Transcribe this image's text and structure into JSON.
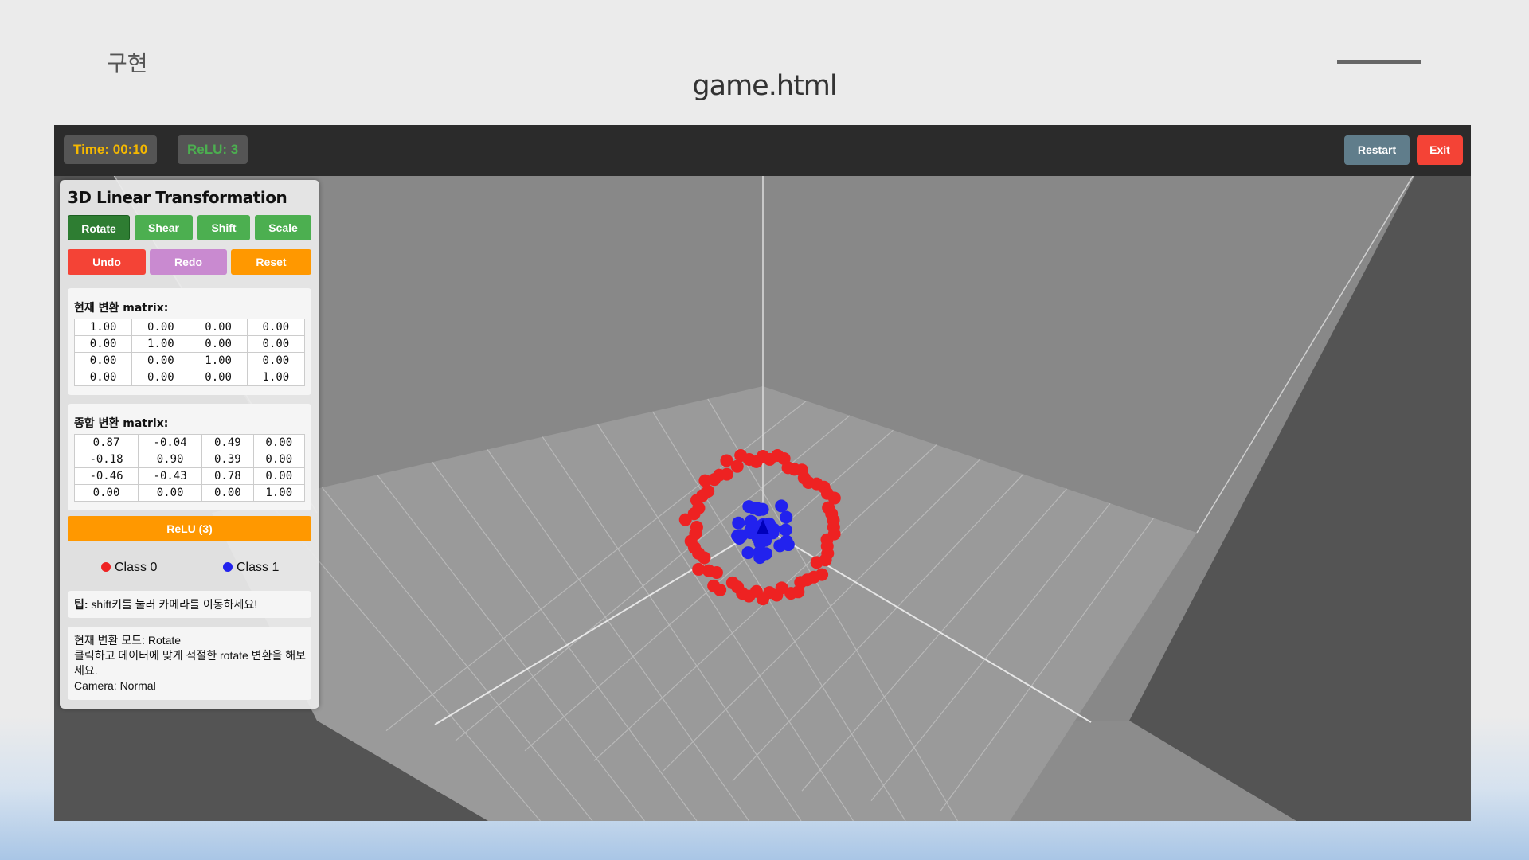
{
  "slide": {
    "label": "구현",
    "title": "game.html"
  },
  "hud": {
    "time": "Time: 00:10",
    "relu": "ReLU: 3"
  },
  "top_buttons": {
    "restart": "Restart",
    "exit": "Exit"
  },
  "panel": {
    "title": "3D Linear Transformation",
    "mode_buttons": [
      "Rotate",
      "Shear",
      "Shift",
      "Scale"
    ],
    "active_mode": "Rotate",
    "history_buttons": {
      "undo": "Undo",
      "redo": "Redo",
      "reset": "Reset"
    },
    "current_matrix": {
      "label": "현재 변환 matrix:",
      "rows": [
        [
          "1.00",
          "0.00",
          "0.00",
          "0.00"
        ],
        [
          "0.00",
          "1.00",
          "0.00",
          "0.00"
        ],
        [
          "0.00",
          "0.00",
          "1.00",
          "0.00"
        ],
        [
          "0.00",
          "0.00",
          "0.00",
          "1.00"
        ]
      ]
    },
    "combined_matrix": {
      "label": "종합 변환 matrix:",
      "rows": [
        [
          "0.87",
          "-0.04",
          "0.49",
          "0.00"
        ],
        [
          "-0.18",
          "0.90",
          "0.39",
          "0.00"
        ],
        [
          "-0.46",
          "-0.43",
          "0.78",
          "0.00"
        ],
        [
          "0.00",
          "0.00",
          "0.00",
          "1.00"
        ]
      ]
    },
    "relu_button": "ReLU (3)",
    "legend": {
      "class0": "Class 0",
      "class1": "Class 1"
    },
    "tip": {
      "prefix": "팁:",
      "text": " shift키를 눌러 카메라를 이동하세요!"
    },
    "info": {
      "line1": "현재 변환 모드: Rotate",
      "line2": "클릭하고 데이터에 맞게 적절한 rotate 변환을 해보세요.",
      "line3": "Camera: Normal"
    }
  },
  "colors": {
    "class0": "#ee2222",
    "class1": "#2222ee",
    "time": "#f5b800",
    "relu": "#4caf50",
    "accent_orange": "#ff9800"
  }
}
